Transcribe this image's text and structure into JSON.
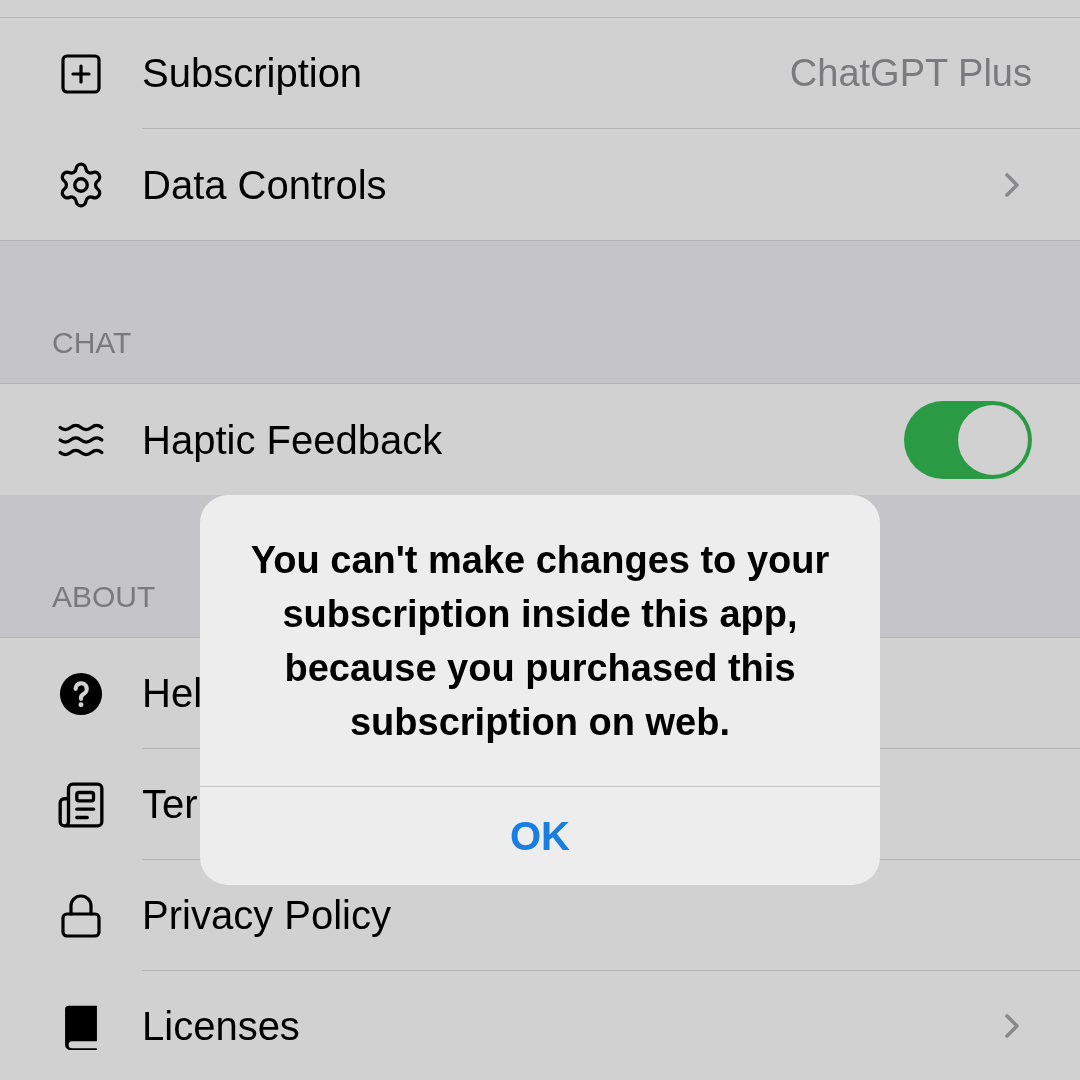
{
  "sections": [
    {
      "rows": [
        {
          "kind": "value",
          "label": "Subscription",
          "value": "ChatGPT Plus"
        },
        {
          "kind": "chevron",
          "label": "Data Controls"
        }
      ]
    },
    {
      "header": "CHAT",
      "rows": [
        {
          "kind": "toggle",
          "label": "Haptic Feedback",
          "on": true
        }
      ]
    },
    {
      "header": "ABOUT",
      "rows": [
        {
          "kind": "plain",
          "label": "Hel"
        },
        {
          "kind": "plain",
          "label": "Ter"
        },
        {
          "kind": "plain",
          "label": "Privacy Policy"
        },
        {
          "kind": "chevron",
          "label": "Licenses"
        }
      ]
    }
  ],
  "alert": {
    "message": "You can't make changes to your subscription inside this app, because you purchased this subscription on web.",
    "button": "OK"
  }
}
